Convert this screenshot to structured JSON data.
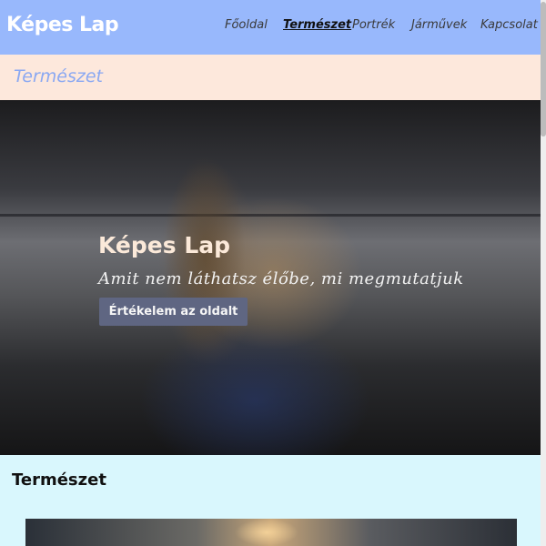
{
  "navbar": {
    "brand": "Képes Lap",
    "items": [
      {
        "label": "Főoldal",
        "active": false
      },
      {
        "label": "Természet",
        "active": true
      },
      {
        "label": "Portrék",
        "active": false
      },
      {
        "label": "Járművek",
        "active": false
      },
      {
        "label": "Kapcsolat",
        "active": false
      }
    ]
  },
  "page_header": {
    "title": "Természet"
  },
  "hero": {
    "title": "Képes Lap",
    "subtitle": "Amit nem láthatsz élőbe, mi megmutatjuk",
    "button_label": "Értékelem az oldalt"
  },
  "section": {
    "title": "Természet"
  },
  "colors": {
    "navbar_bg": "#98b8fc",
    "page_header_bg": "#fde8dc",
    "section_bg": "#d9f7fd",
    "button_bg": "#5f6682"
  }
}
